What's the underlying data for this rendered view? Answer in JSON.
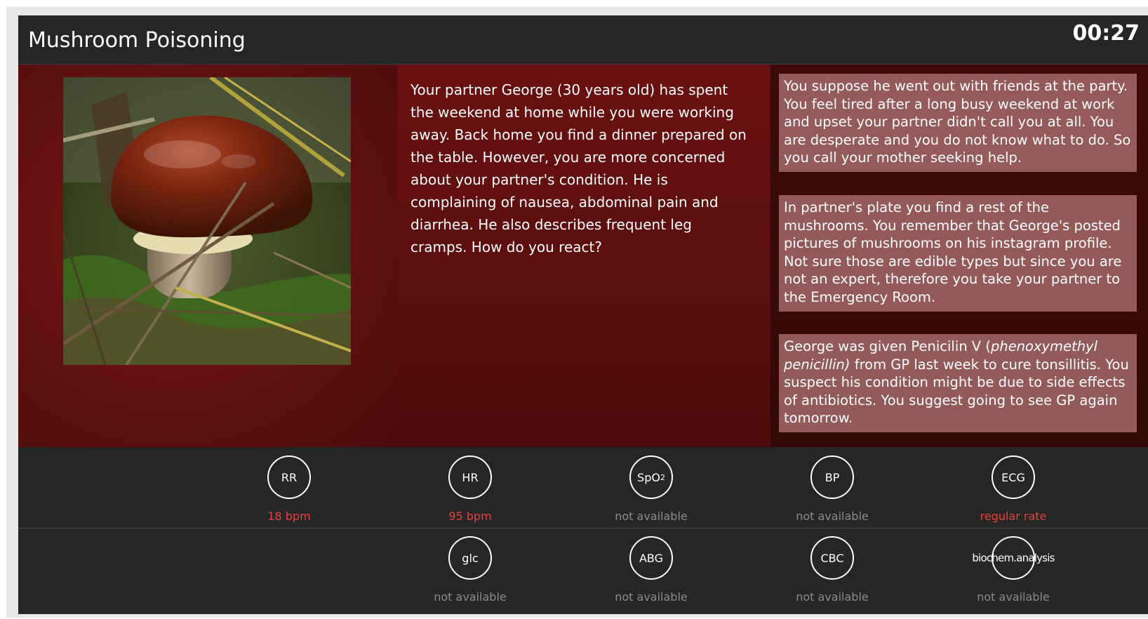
{
  "header": {
    "title": "Mushroom Poisoning",
    "timer": "00:27"
  },
  "scene": {
    "image_alt": "mushroom-photo",
    "story": "Your partner George (30 years old) has spent the weekend at home while you were working away. Back home you find a dinner prepared on the table. However, you are more concerned about your partner's condition. He is complaining of nausea, abdominal pain and diarrhea. He also describes frequent leg cramps. How do you react?",
    "options": [
      {
        "text": "You suppose he went out with friends at the party. You feel tired after a long busy weekend at work and upset your partner didn't call you at all. You are desperate and you do not know what to do. So you call your mother seeking help."
      },
      {
        "text": "In partner's plate you find a rest of the mushrooms. You remember that George's posted pictures of mushrooms on his instagram profile. Not sure those are edible types but since you are not an expert, therefore you take your partner to the Emergency Room."
      },
      {
        "text_before": "George was given Penicilin V (",
        "text_italic": "phenoxymethyl penicillin)",
        "text_after": " from GP last week to cure tonsillitis. You suspect his condition might be due to side effects of antibiotics. You suggest going to see GP again tomorrow."
      }
    ]
  },
  "vitals": [
    {
      "label": "RR",
      "value": "18 bpm",
      "status": "alert"
    },
    {
      "label": "HR",
      "value": "95 bpm",
      "status": "alert"
    },
    {
      "label": "SpO",
      "label_sub": "2",
      "value": "not available",
      "status": "muted"
    },
    {
      "label": "BP",
      "value": "not available",
      "status": "muted"
    },
    {
      "label": "ECG",
      "value": "regular rate",
      "status": "alert"
    }
  ],
  "labs": [
    {
      "label": "glc",
      "value": "not available",
      "status": "muted"
    },
    {
      "label": "ABG",
      "value": "not available",
      "status": "muted"
    },
    {
      "label": "CBC",
      "value": "not available",
      "status": "muted"
    },
    {
      "label": "biochem.analysis",
      "value": "not available",
      "status": "muted"
    }
  ],
  "colors": {
    "alert": "#e8423a",
    "muted": "#8c8c8c",
    "scene_red": "#6a1010"
  }
}
